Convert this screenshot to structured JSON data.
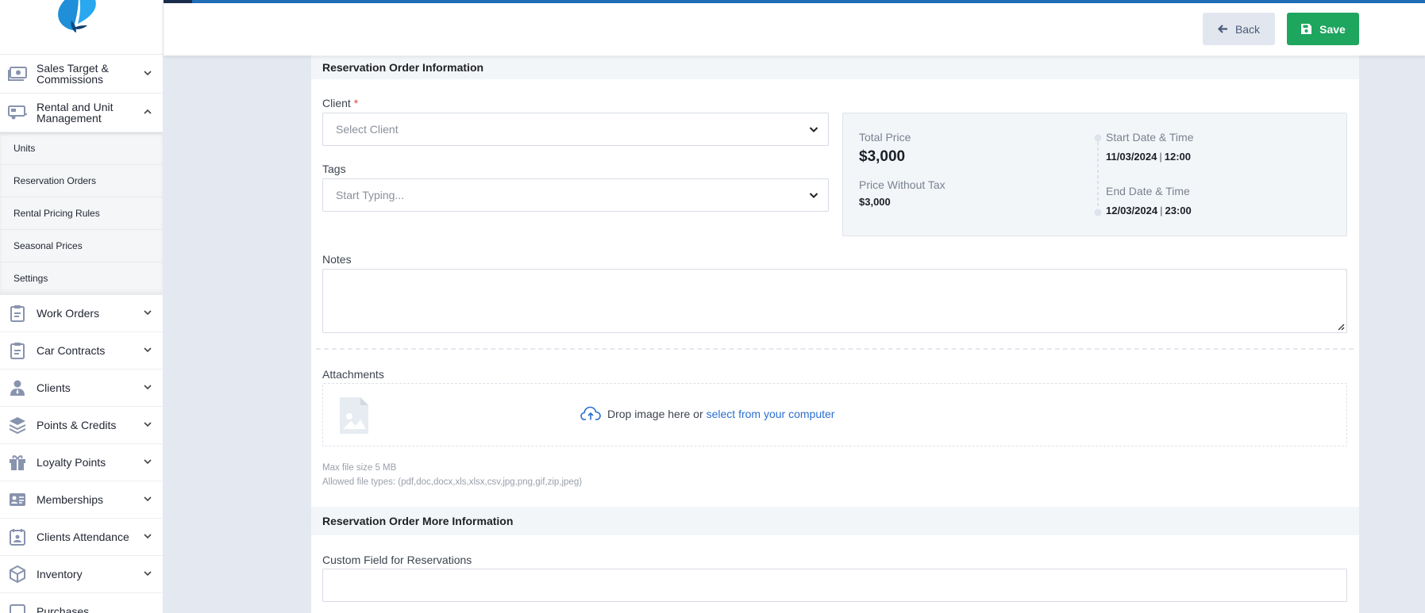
{
  "sidebar": {
    "items_top": [
      {
        "label": "Sales Target & Commissions",
        "icon": "money-icon"
      },
      {
        "label": "Rental and Unit Management",
        "icon": "rv-icon"
      }
    ],
    "sub_items": [
      "Units",
      "Reservation Orders",
      "Rental Pricing Rules",
      "Seasonal Prices",
      "Settings"
    ],
    "items_bottom": [
      {
        "label": "Work Orders",
        "icon": "clipboard-icon"
      },
      {
        "label": "Car Contracts",
        "icon": "clipboard-icon"
      },
      {
        "label": "Clients",
        "icon": "user-tie-icon"
      },
      {
        "label": "Points & Credits",
        "icon": "layers-icon"
      },
      {
        "label": "Loyalty Points",
        "icon": "gift-icon"
      },
      {
        "label": "Memberships",
        "icon": "id-card-icon"
      },
      {
        "label": "Clients Attendance",
        "icon": "calendar-user-icon"
      },
      {
        "label": "Inventory",
        "icon": "box-icon"
      },
      {
        "label": "Purchases",
        "icon": "cart-icon"
      }
    ]
  },
  "toolbar": {
    "back_label": "Back",
    "save_label": "Save"
  },
  "form": {
    "section1_title": "Reservation Order Information",
    "client_label": "Client",
    "client_required": "*",
    "client_placeholder": "Select Client",
    "tags_label": "Tags",
    "tags_placeholder": "Start Typing...",
    "notes_label": "Notes",
    "attachments_label": "Attachments",
    "dropzone_text": "Drop image here or",
    "dropzone_link": "select from your computer",
    "max_size": "Max file size 5 MB",
    "allowed_types": "Allowed file types: (pdf,doc,docx,xls,xlsx,csv,jpg,png,gif,zip,jpeg)",
    "section2_title": "Reservation Order More Information",
    "custom_field_label": "Custom Field for Reservations"
  },
  "summary": {
    "total_price_label": "Total Price",
    "total_price": "$3,000",
    "price_without_tax_label": "Price Without Tax",
    "price_without_tax": "$3,000",
    "start_label": "Start Date & Time",
    "start_date": "11/03/2024",
    "start_time": "12:00",
    "end_label": "End Date & Time",
    "end_date": "12/03/2024",
    "end_time": "23:00",
    "separator": "|"
  },
  "colors": {
    "accent": "#1f6db6",
    "save": "#1ea55e",
    "link": "#2b6fd1",
    "icon": "#8893ae"
  }
}
